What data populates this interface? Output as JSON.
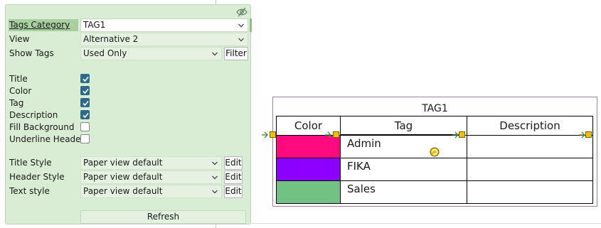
{
  "panel": {
    "tags_category": {
      "label": "Tags Category",
      "value": "TAG1"
    },
    "view": {
      "label": "View",
      "value": "Alternative 2"
    },
    "show_tags": {
      "label": "Show Tags",
      "value": "Used Only",
      "filter_label": "Filter"
    },
    "options": [
      {
        "label": "Title",
        "checked": true
      },
      {
        "label": "Color",
        "checked": true
      },
      {
        "label": "Tag",
        "checked": true
      },
      {
        "label": "Description",
        "checked": true
      },
      {
        "label": "Fill Background",
        "checked": false
      },
      {
        "label": "Underline Header",
        "checked": false
      }
    ],
    "styles": [
      {
        "label": "Title Style",
        "value": "Paper view default",
        "edit_label": "Edit"
      },
      {
        "label": "Header Style",
        "value": "Paper view default",
        "edit_label": "Edit"
      },
      {
        "label": "Text style",
        "value": "Paper view default",
        "edit_label": "Edit"
      }
    ],
    "refresh_label": "Refresh",
    "visibility_icon": "eye-slash-icon"
  },
  "table": {
    "title": "TAG1",
    "headers": [
      "Color",
      "Tag",
      "Description"
    ],
    "rows": [
      {
        "color": "#ff0a7f",
        "tag": "Admin",
        "description": ""
      },
      {
        "color": "#8b00ff",
        "tag": "FIKA",
        "description": ""
      },
      {
        "color": "#72c284",
        "tag": "Sales",
        "description": ""
      }
    ]
  },
  "colors": {
    "panel_bg": "#d9ecd4",
    "highlight": "#a9cfa0",
    "checkbox": "#2e6a8e",
    "frame": "#a77ba7",
    "handle": "#f2c200"
  }
}
